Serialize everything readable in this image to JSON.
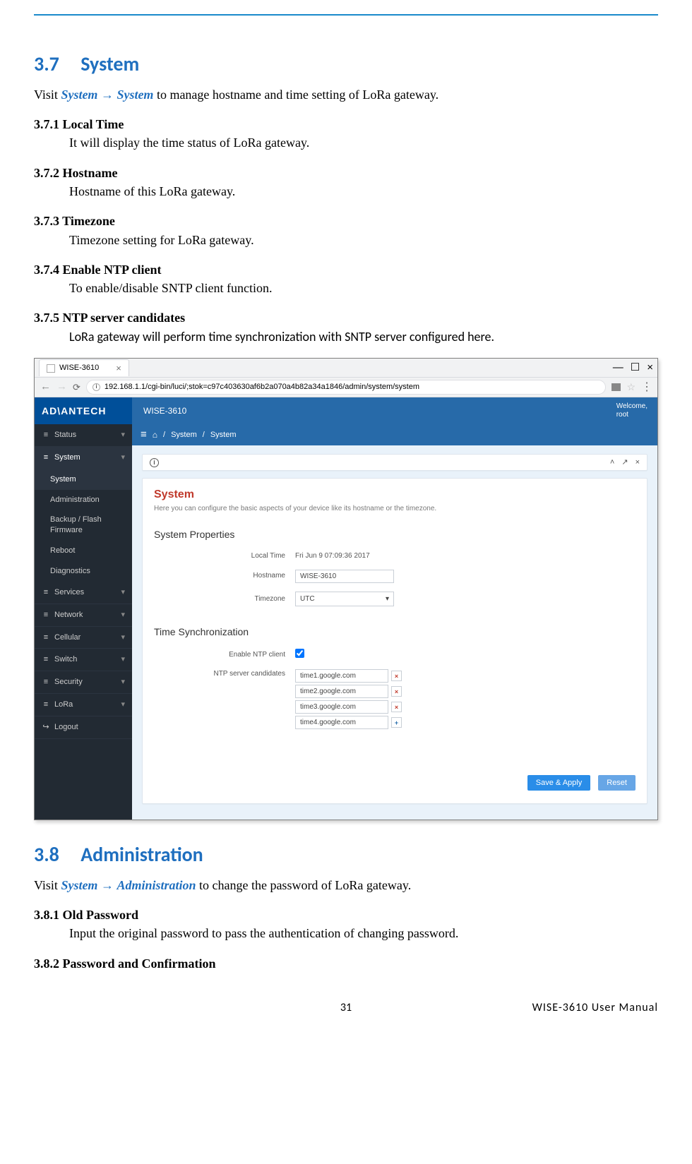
{
  "doc": {
    "s37_num": "3.7",
    "s37_title": "System",
    "s37_intro_pre": "Visit ",
    "s37_intro_nav1": "System",
    "s37_intro_arrow": "→",
    "s37_intro_nav2": "System",
    "s37_intro_post": " to manage hostname and time setting of LoRa gateway.",
    "s371_t": "3.7.1 Local Time",
    "s371_d": "It will display the time status of LoRa gateway.",
    "s372_t": "3.7.2 Hostname",
    "s372_d": "Hostname of this LoRa gateway.",
    "s373_t": "3.7.3 Timezone",
    "s373_d": "Timezone setting for LoRa gateway.",
    "s374_t": "3.7.4 Enable NTP client",
    "s374_d": "To enable/disable SNTP client function.",
    "s375_t": "3.7.5 NTP server candidates",
    "s375_d": "LoRa gateway will perform time synchronization with SNTP server configured here.",
    "s38_num": "3.8",
    "s38_title": "Administration",
    "s38_intro_pre": "Visit ",
    "s38_intro_nav1": "System",
    "s38_intro_arrow": "→",
    "s38_intro_nav2": "Administration",
    "s38_intro_post": " to change the password of LoRa gateway.",
    "s381_t": "3.8.1 Old Password",
    "s381_d": "Input the original password to pass the authentication of changing password.",
    "s382_t": "3.8.2 Password and Confirmation",
    "page_num": "31",
    "manual_name": "WISE-3610  User  Manual"
  },
  "browser": {
    "tab_title": "WISE-3610",
    "url": "192.168.1.1/cgi-bin/luci/;stok=c97c403630af6b2a070a4b82a34a1846/admin/system/system",
    "win_min": "—",
    "win_max": "☐",
    "win_close": "×"
  },
  "app": {
    "brand": "AD\\ANTECH",
    "product": "WISE-3610",
    "welcome_l1": "Welcome,",
    "welcome_l2": "root",
    "breadcrumb_a": "System",
    "breadcrumb_b": "System",
    "sidebar": {
      "items": [
        {
          "label": "Status",
          "ico": "≡"
        },
        {
          "label": "System",
          "ico": "≡"
        },
        {
          "label": "Services",
          "ico": "≡"
        },
        {
          "label": "Network",
          "ico": "≡"
        },
        {
          "label": "Cellular",
          "ico": "≡"
        },
        {
          "label": "Switch",
          "ico": "≡"
        },
        {
          "label": "Security",
          "ico": "≡"
        },
        {
          "label": "LoRa",
          "ico": "≡"
        },
        {
          "label": "Logout",
          "ico": "↪"
        }
      ],
      "subitems": [
        {
          "label": "System"
        },
        {
          "label": "Administration"
        },
        {
          "label": "Backup / Flash Firmware"
        },
        {
          "label": "Reboot"
        },
        {
          "label": "Diagnostics"
        }
      ]
    },
    "panel": {
      "title": "System",
      "desc": "Here you can configure the basic aspects of your device like its hostname or the timezone.",
      "sprops": "System Properties",
      "tsync": "Time Synchronization",
      "form": {
        "local_time_label": "Local Time",
        "local_time_value": "Fri Jun 9 07:09:36 2017",
        "hostname_label": "Hostname",
        "hostname_value": "WISE-3610",
        "timezone_label": "Timezone",
        "timezone_value": "UTC",
        "enable_ntp_label": "Enable NTP client",
        "ntp_candidates_label": "NTP server candidates",
        "ntp": [
          "time1.google.com",
          "time2.google.com",
          "time3.google.com",
          "time4.google.com"
        ]
      },
      "btn_save": "Save & Apply",
      "btn_reset": "Reset"
    }
  }
}
